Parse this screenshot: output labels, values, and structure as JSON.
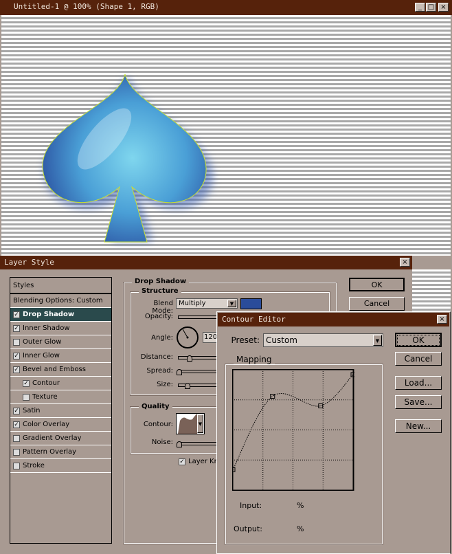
{
  "document": {
    "title": "Untitled-1 @ 100% (Shape 1, RGB)",
    "controls": [
      "_",
      "□",
      "×"
    ],
    "shape_color": "#2e5fa8"
  },
  "layer_style": {
    "title": "Layer Style",
    "close": "×",
    "styles_header": "Styles",
    "blending": "Blending Options: Custom",
    "items": [
      {
        "label": "Drop Shadow",
        "checked": true,
        "selected": true
      },
      {
        "label": "Inner Shadow",
        "checked": true
      },
      {
        "label": "Outer Glow",
        "checked": false
      },
      {
        "label": "Inner Glow",
        "checked": true
      },
      {
        "label": "Bevel and Emboss",
        "checked": true
      },
      {
        "label": "Contour",
        "checked": true,
        "sub": true
      },
      {
        "label": "Texture",
        "checked": false,
        "sub": true
      },
      {
        "label": "Satin",
        "checked": true
      },
      {
        "label": "Color Overlay",
        "checked": true
      },
      {
        "label": "Gradient Overlay",
        "checked": false
      },
      {
        "label": "Pattern Overlay",
        "checked": false
      },
      {
        "label": "Stroke",
        "checked": false
      }
    ],
    "section": "Drop Shadow",
    "structure": "Structure",
    "blend_mode_label": "Blend Mode:",
    "blend_mode": "Multiply",
    "shadow_color": "#2a4c9a",
    "opacity_label": "Opacity:",
    "angle_label": "Angle:",
    "angle": "120",
    "distance_label": "Distance:",
    "spread_label": "Spread:",
    "size_label": "Size:",
    "quality": "Quality",
    "contour_label": "Contour:",
    "noise_label": "Noise:",
    "layer_knocks": "Layer Kn",
    "ok": "OK",
    "cancel": "Cancel"
  },
  "contour_editor": {
    "title": "Contour Editor",
    "close": "×",
    "preset_label": "Preset:",
    "preset": "Custom",
    "mapping": "Mapping",
    "input_label": "Input:",
    "output_label": "Output:",
    "percent": "%",
    "ok": "OK",
    "cancel": "Cancel",
    "load": "Load...",
    "save": "Save...",
    "new": "New...",
    "curve_points": [
      [
        0,
        17
      ],
      [
        33,
        78
      ],
      [
        73,
        70
      ],
      [
        100,
        96
      ]
    ]
  }
}
